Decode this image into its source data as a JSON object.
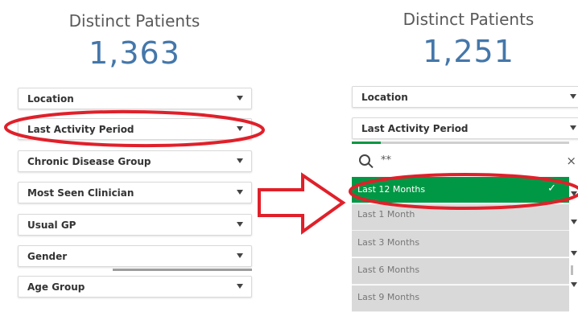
{
  "left_panel": {
    "kpi_title": "Distinct Patients",
    "kpi_value": "1,363",
    "filters": [
      {
        "label": "Location"
      },
      {
        "label": "Last Activity Period"
      },
      {
        "label": "Chronic Disease Group"
      },
      {
        "label": "Most Seen Clinician"
      },
      {
        "label": "Usual GP"
      },
      {
        "label": "Gender"
      },
      {
        "label": "Age Group"
      }
    ]
  },
  "right_panel": {
    "kpi_title": "Distinct Patients",
    "kpi_value": "1,251",
    "filters": [
      {
        "label": "Location"
      },
      {
        "label": "Last Activity Period"
      }
    ],
    "search": {
      "value": "**",
      "clear_icon": "×"
    },
    "list_items": [
      {
        "label": "Last 12 Months",
        "selected": true
      },
      {
        "label": "Last 1 Month",
        "selected": false
      },
      {
        "label": "Last 3 Months",
        "selected": false
      },
      {
        "label": "Last 6 Months",
        "selected": false
      },
      {
        "label": "Last 9 Months",
        "selected": false
      }
    ],
    "check_icon": "✓"
  },
  "annotation": {
    "color": "#e0202a"
  },
  "colors": {
    "accent_green": "#009845",
    "kpi_blue": "#4477aa"
  }
}
